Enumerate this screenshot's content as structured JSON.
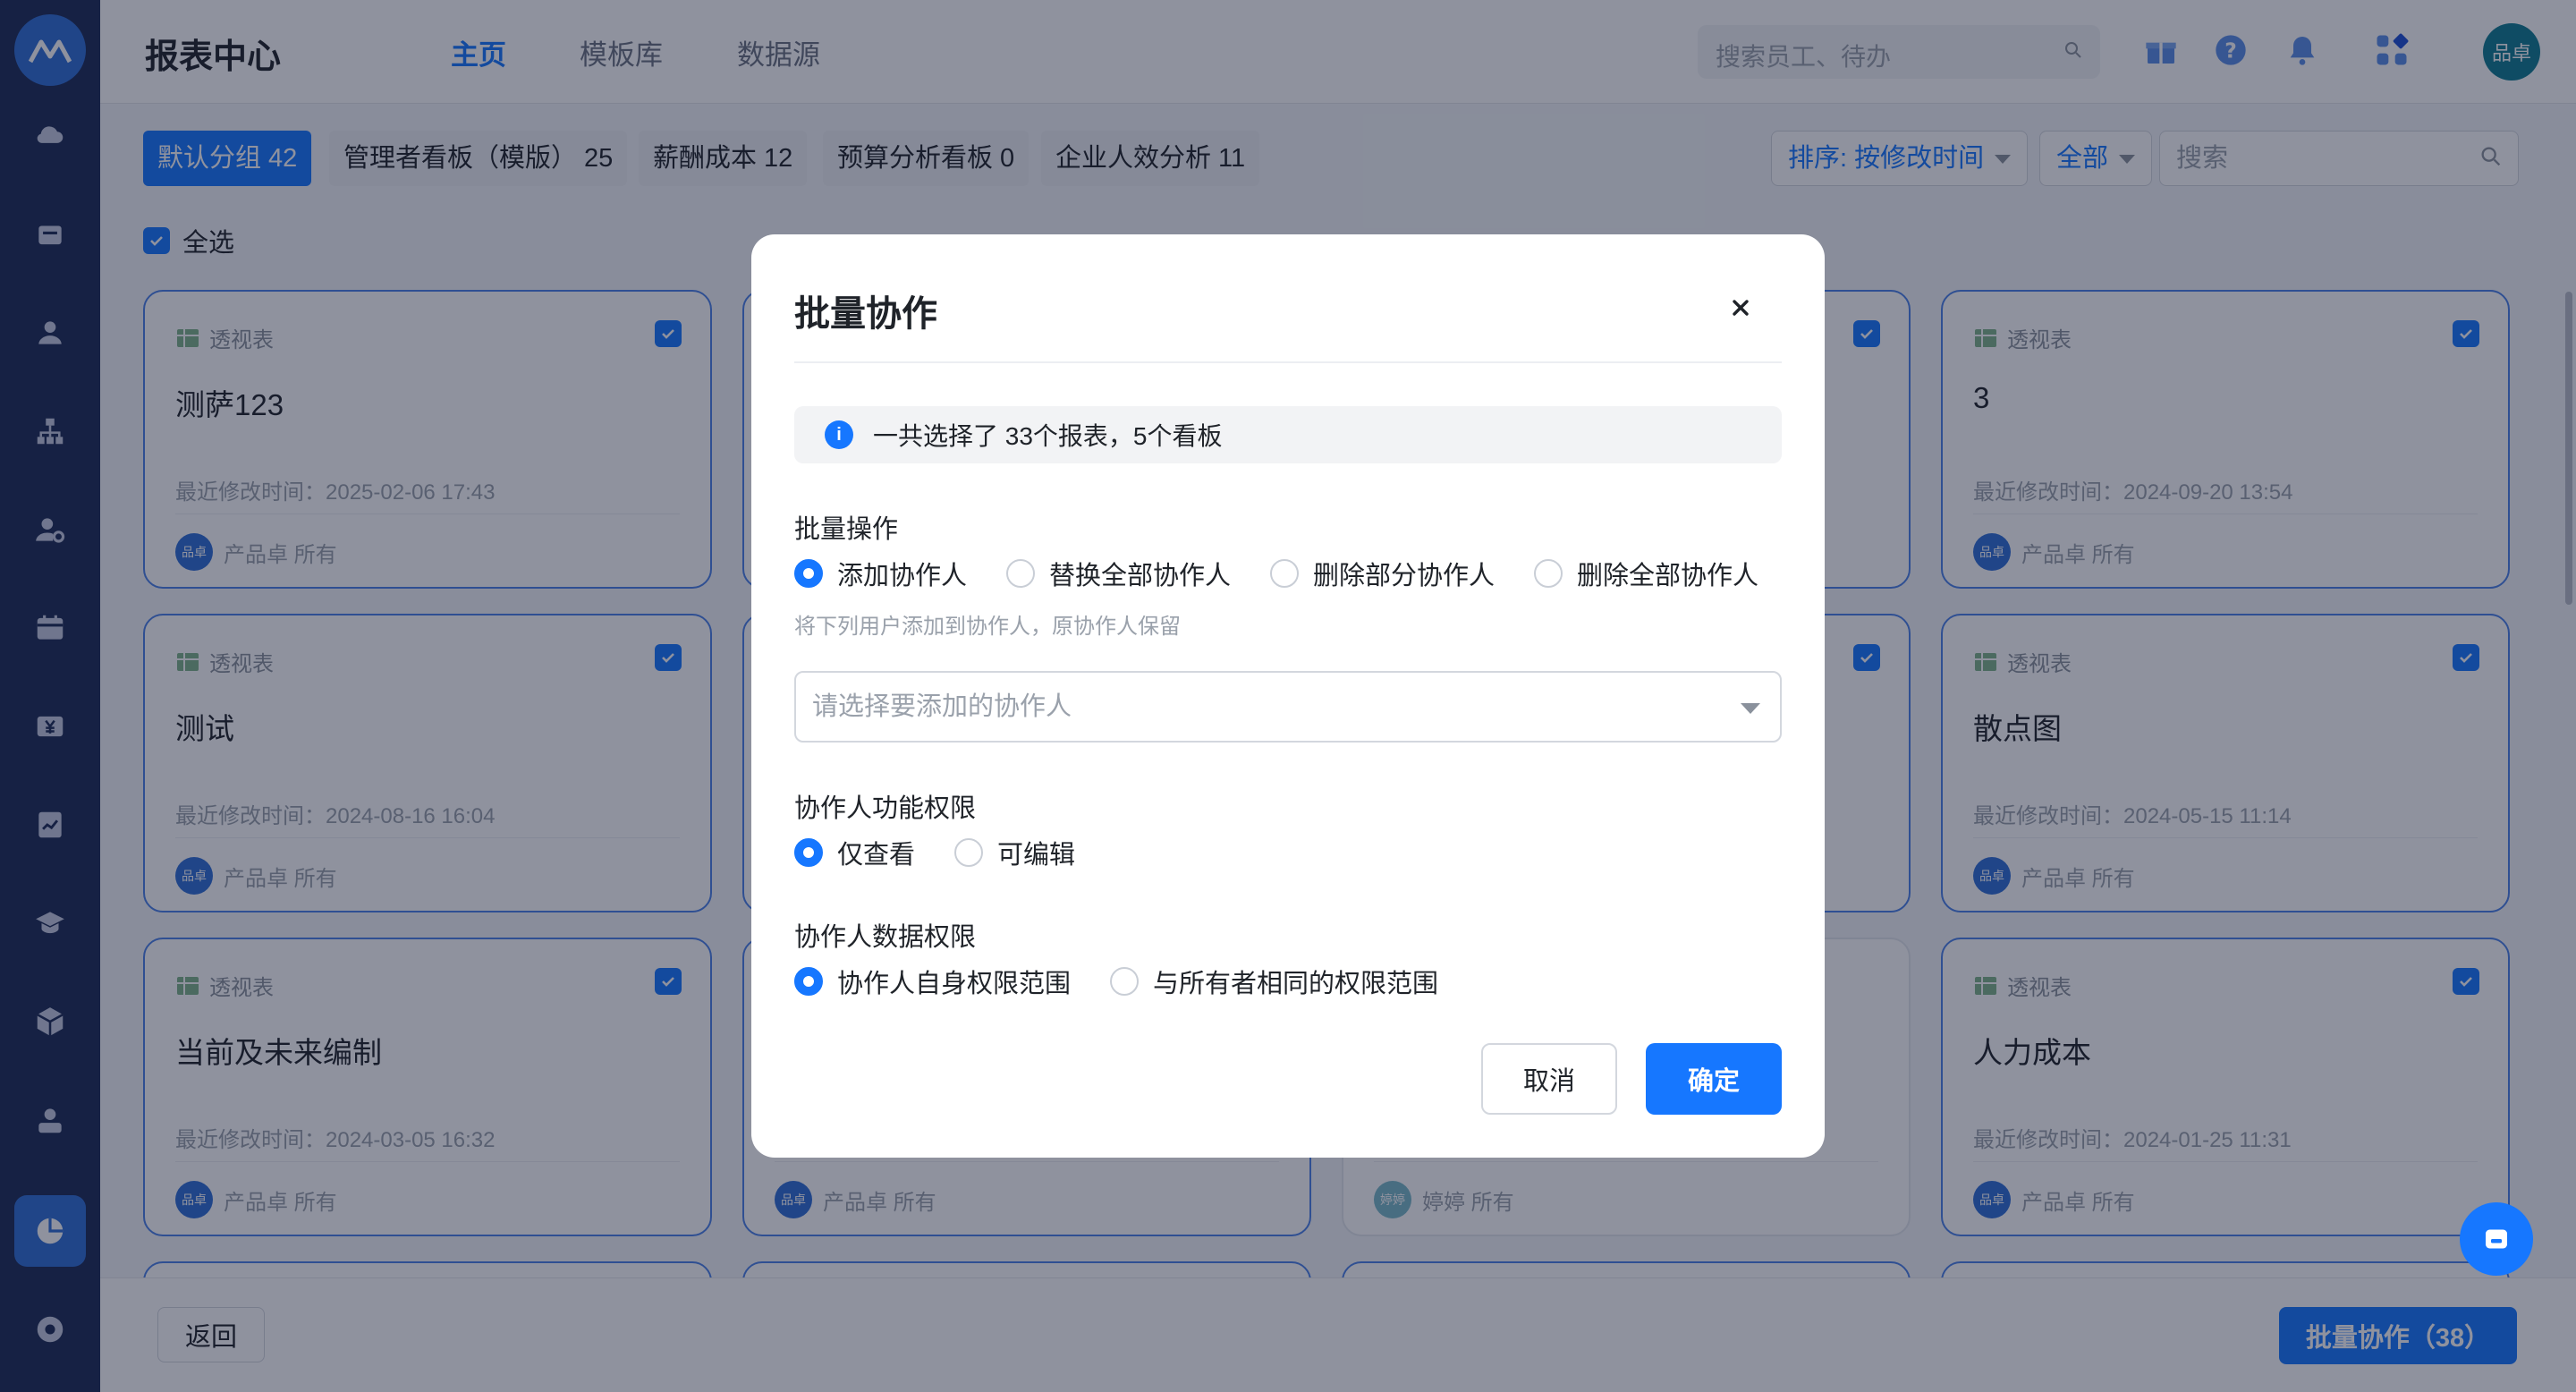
{
  "app": {
    "title": "报表中心",
    "avatar_text": "品卓"
  },
  "top_tabs": [
    "主页",
    "模板库",
    "数据源"
  ],
  "top_search": {
    "placeholder": "搜索员工、待办"
  },
  "groups": [
    {
      "label": "默认分组 42"
    },
    {
      "label": "管理者看板（模版） 25"
    },
    {
      "label": "薪酬成本 12"
    },
    {
      "label": "预算分析看板 0"
    },
    {
      "label": "企业人效分析 11"
    }
  ],
  "sort": {
    "label": "排序: 按修改时间",
    "scope": "全部",
    "search_placeholder": "搜索"
  },
  "select_all_label": "全选",
  "cards": [
    {
      "type": "透视表",
      "name": "测萨123",
      "time": "最近修改时间：2025-02-06 17:43",
      "owner": "产品卓 所有",
      "avatar": "品卓"
    },
    {
      "type": "透视表",
      "name": "3",
      "time": "最近修改时间：2024-09-20 13:54",
      "owner": "产品卓 所有",
      "avatar": "品卓"
    },
    {
      "type": "透视表",
      "name": "测试",
      "time": "最近修改时间：2024-08-16 16:04",
      "owner": "产品卓 所有",
      "avatar": "品卓"
    },
    {
      "type": "透视表",
      "name": "散点图",
      "time": "最近修改时间：2024-05-15 11:14",
      "owner": "产品卓 所有",
      "avatar": "品卓"
    },
    {
      "type": "透视表",
      "name": "当前及未来编制",
      "time": "最近修改时间：2024-03-05 16:32",
      "owner": "产品卓 所有",
      "avatar": "品卓"
    },
    {
      "type": "透视表",
      "name": "人力成本",
      "time": "最近修改时间：2024-01-25 11:31",
      "owner": "产品卓 所有",
      "avatar": "品卓"
    },
    {
      "owner": "产品卓 所有",
      "avatar": "品卓"
    },
    {
      "owner": "婷婷 所有",
      "avatar": "婷婷"
    }
  ],
  "bottom": {
    "back_label": "返回",
    "batch_label": "批量协作（38）"
  },
  "modal": {
    "title": "批量协作",
    "info": "一共选择了 33个报表，5个看板",
    "batch_op_label": "批量操作",
    "batch_ops": [
      "添加协作人",
      "替换全部协作人",
      "删除部分协作人",
      "删除全部协作人"
    ],
    "batch_op_selected": "添加协作人",
    "hint": "将下列用户添加到协作人，原协作人保留",
    "select_placeholder": "请选择要添加的协作人",
    "func_perm_label": "协作人功能权限",
    "func_perms": [
      "仅查看",
      "可编辑"
    ],
    "func_perm_selected": "仅查看",
    "data_perm_label": "协作人数据权限",
    "data_perms": [
      "协作人自身权限范围",
      "与所有者相同的权限范围"
    ],
    "data_perm_selected": "协作人自身权限范围",
    "cancel_label": "取消",
    "ok_label": "确定"
  },
  "colors": {
    "primary": "#1677ff",
    "sidebar": "#1b2a55",
    "card_border": "#4a80e8"
  }
}
